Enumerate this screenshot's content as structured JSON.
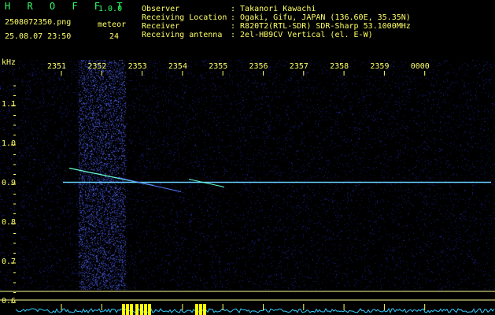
{
  "app": {
    "title": "H R O F F T",
    "version": "1.0.0"
  },
  "file": {
    "name": "2508072350.png",
    "datetime": "25.08.07 23:50"
  },
  "meteor": {
    "label": "meteor",
    "count": "24"
  },
  "info": {
    "labels": [
      "Observer",
      "Receiving Location",
      "Receiver",
      "Receiving antenna"
    ],
    "values": [
      ": Takanori Kawachi",
      ": Ogaki, Gifu, JAPAN (136.60E, 35.35N)",
      ": R820T2(RTL-SDR) SDR-Sharp 53.1000MHz",
      ": 2el-HB9CV Vertical (el. E-W)"
    ]
  },
  "colors": {
    "background": "#000000",
    "text": "#ffff66",
    "title": "#33ff66",
    "noise": "#1a1a8c",
    "signal": "#66ccff",
    "spectrum": "#33ccff",
    "spectrum_peak": "#ffff00"
  },
  "chart_data": {
    "type": "heatmap",
    "ylabel": "kHz",
    "y_ticks": [
      "1.1",
      "1.0",
      "0.9",
      "0.8",
      "0.7",
      "0.6"
    ],
    "x_ticks": [
      "2351",
      "2352",
      "2353",
      "2354",
      "2355",
      "2356",
      "2357",
      "2358",
      "2359",
      "0000"
    ],
    "carrier_khz": 0.905,
    "ylim": [
      0.58,
      1.17
    ]
  }
}
